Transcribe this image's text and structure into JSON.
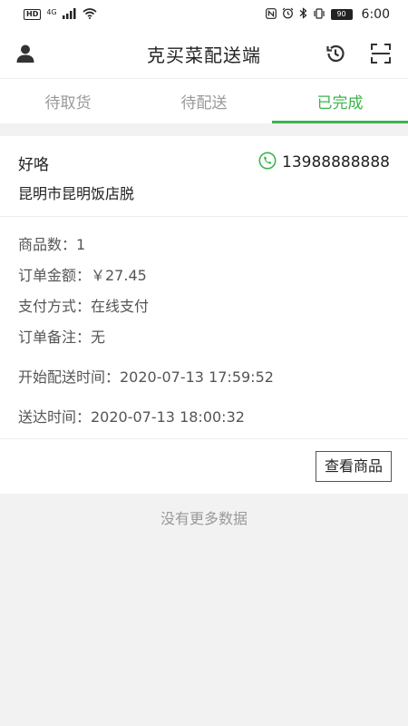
{
  "status_bar": {
    "left": [
      "HD",
      "4G"
    ],
    "battery": "90",
    "time": "6:00"
  },
  "header": {
    "title": "克买菜配送端",
    "icons": [
      "user-icon",
      "history-icon",
      "scan-icon"
    ]
  },
  "tabs": [
    {
      "label": "待取货",
      "active": false
    },
    {
      "label": "待配送",
      "active": false
    },
    {
      "label": "已完成",
      "active": true
    }
  ],
  "order": {
    "customer_name": "好咯",
    "phone": "13988888888",
    "address": "昆明市昆明饭店脱",
    "item_count": "商品数：1",
    "amount": "订单金额：￥27.45",
    "payment": "支付方式：在线支付",
    "note": "订单备注：无",
    "start_time": "开始配送时间：2020-07-13 17:59:52",
    "delivered_time": "送达时间：2020-07-13 18:00:32",
    "view_button": "查看商品"
  },
  "footer": {
    "no_more": "没有更多数据"
  },
  "colors": {
    "accent": "#3cb44b",
    "inactive_tab": "#999999",
    "background": "#f2f2f2"
  }
}
